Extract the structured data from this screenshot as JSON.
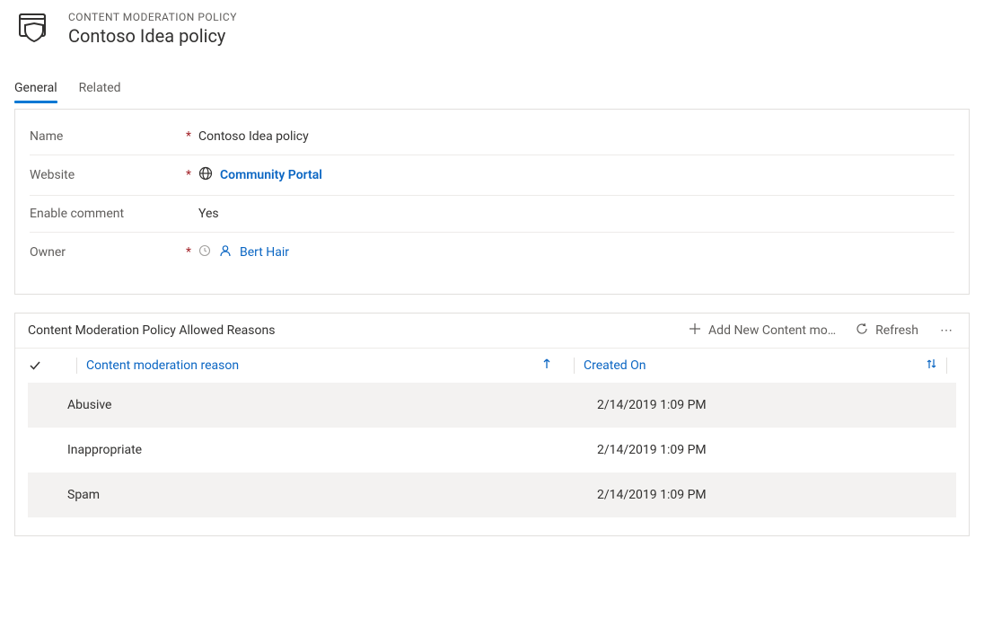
{
  "header": {
    "subtitle": "CONTENT MODERATION POLICY",
    "title": "Contoso Idea policy"
  },
  "tabs": [
    {
      "label": "General",
      "active": true
    },
    {
      "label": "Related",
      "active": false
    }
  ],
  "form": {
    "name": {
      "label": "Name",
      "required": true,
      "value": "Contoso Idea policy"
    },
    "website": {
      "label": "Website",
      "required": true,
      "value": "Community Portal"
    },
    "enable": {
      "label": "Enable comment",
      "required": false,
      "value": "Yes"
    },
    "owner": {
      "label": "Owner",
      "required": true,
      "value": "Bert Hair"
    }
  },
  "subgrid": {
    "title": "Content Moderation Policy Allowed Reasons",
    "actions": {
      "add": "Add New Content mo…",
      "refresh": "Refresh"
    },
    "columns": {
      "reason": "Content moderation reason",
      "created": "Created On"
    },
    "rows": [
      {
        "reason": "Abusive",
        "created": "2/14/2019 1:09 PM"
      },
      {
        "reason": "Inappropriate",
        "created": "2/14/2019 1:09 PM"
      },
      {
        "reason": "Spam",
        "created": "2/14/2019 1:09 PM"
      }
    ]
  }
}
